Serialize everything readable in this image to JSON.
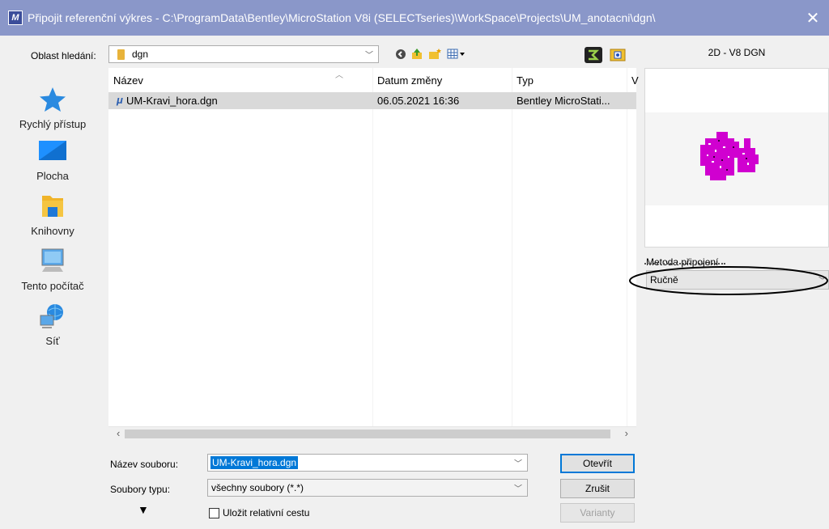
{
  "window": {
    "title": "Připojit referenční výkres - C:\\ProgramData\\Bentley\\MicroStation V8i (SELECTseries)\\WorkSpace\\Projects\\UM_anotacni\\dgn\\",
    "close_glyph": "✕"
  },
  "lookin": {
    "label": "Oblast hledání:",
    "value": "dgn"
  },
  "places": [
    {
      "label": "Rychlý přístup",
      "icon": "star-icon"
    },
    {
      "label": "Plocha",
      "icon": "desktop-icon"
    },
    {
      "label": "Knihovny",
      "icon": "libraries-icon"
    },
    {
      "label": "Tento počítač",
      "icon": "computer-icon"
    },
    {
      "label": "Síť",
      "icon": "network-icon"
    }
  ],
  "columns": [
    "Název",
    "Datum změny",
    "Typ",
    "V"
  ],
  "files": [
    {
      "name": "UM-Kravi_hora.dgn",
      "modified": "06.05.2021 16:36",
      "type": "Bentley MicroStati..."
    }
  ],
  "filename": {
    "label": "Název souboru:",
    "value": "UM-Kravi_hora.dgn"
  },
  "filetype": {
    "label": "Soubory typu:",
    "value": "všechny soubory (*.*)"
  },
  "relative_path": {
    "label": "Uložit relativní cestu",
    "checked": false
  },
  "buttons": {
    "open": "Otevřít",
    "cancel": "Zrušit",
    "options": "Varianty"
  },
  "preview": {
    "header": "2D - V8 DGN"
  },
  "attach_method": {
    "label": "Metoda připojení",
    "value": "Ručně"
  },
  "colors": {
    "titlebar": "#8a97c9",
    "preview_magenta": "#d000d0",
    "selection": "#d9d9d9"
  }
}
